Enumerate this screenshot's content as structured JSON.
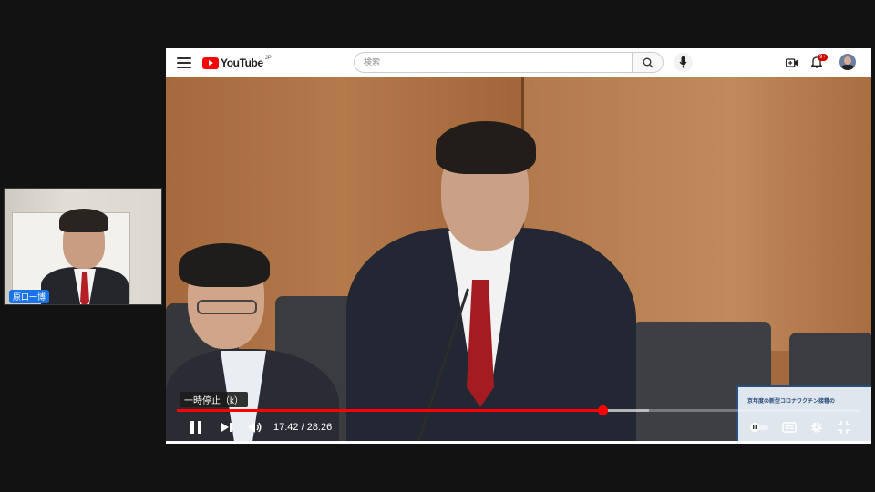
{
  "webcam": {
    "name_tag": "原口一博"
  },
  "youtube": {
    "logo_text": "YouTube",
    "logo_sup": "JP",
    "search": {
      "placeholder": "検索"
    },
    "notification_count": "9+"
  },
  "player": {
    "tooltip": "一時停止（k）",
    "current_time": "17:42",
    "duration": "28:26",
    "time_display": "17:42 / 28:26",
    "progress_fraction": 0.623,
    "buffered_fraction": 0.69,
    "sign_text": "京年度の新型コロナワクチン接種の"
  },
  "colors": {
    "accent": "#ff0000",
    "badge": "#cc0000"
  }
}
